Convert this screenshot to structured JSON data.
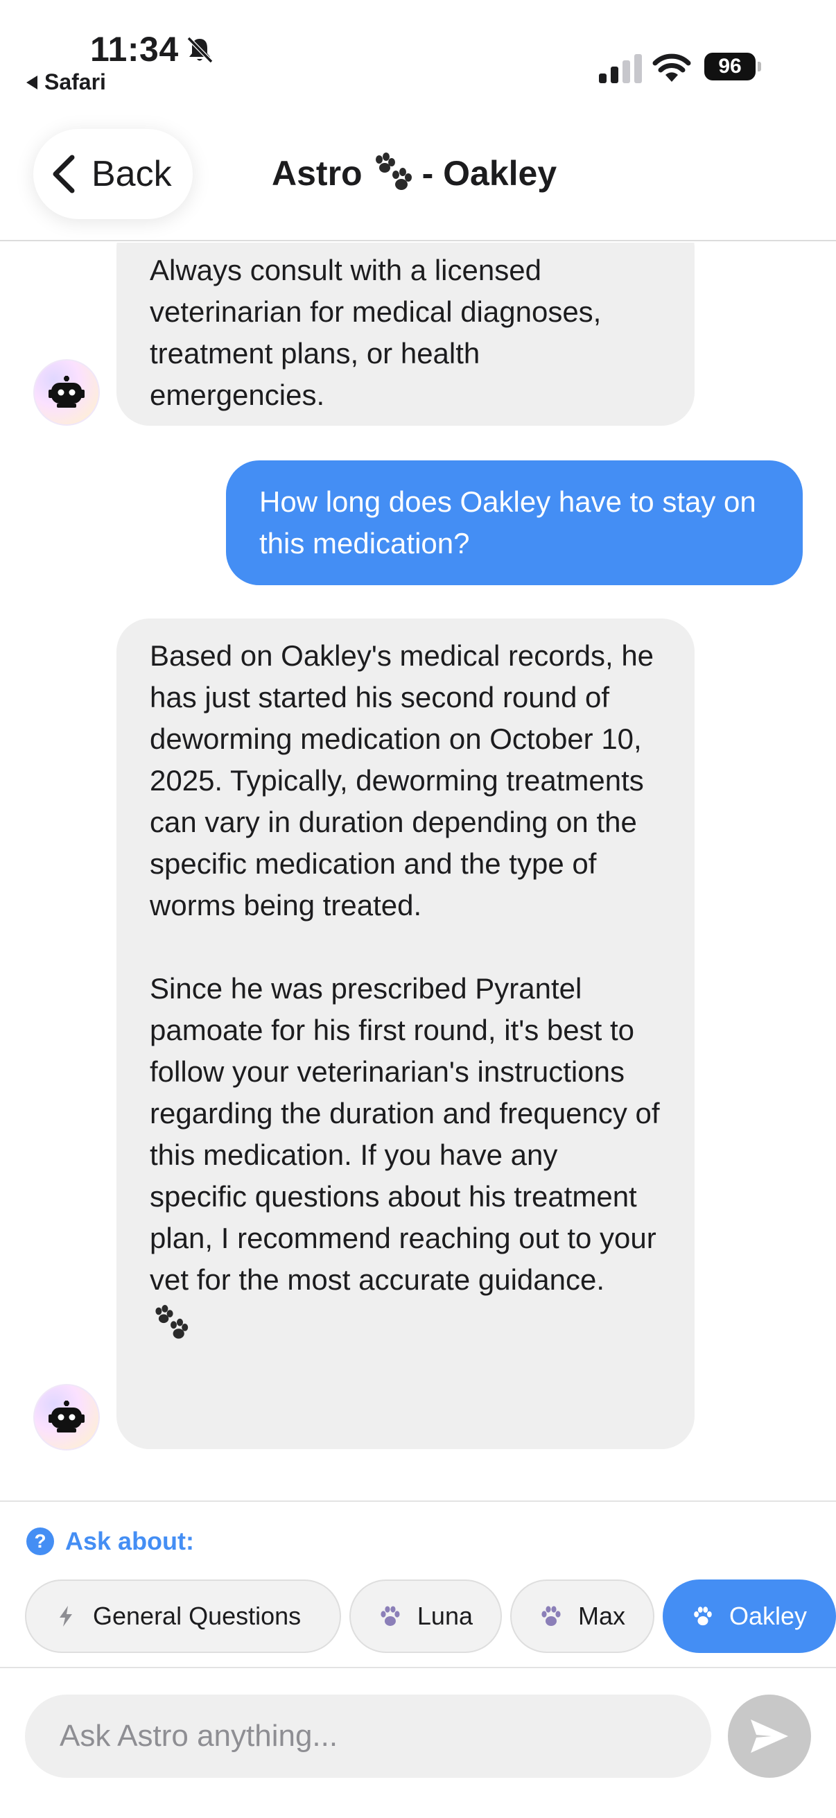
{
  "status_bar": {
    "time": "11:34",
    "back_app": "Safari",
    "battery": "96"
  },
  "nav": {
    "back_label": "Back",
    "title_prefix": "Astro",
    "title_suffix": "- Oakley"
  },
  "messages": [
    {
      "role": "assistant",
      "paragraphs": [
        "Always consult with a licensed veterinarian for medical diagnoses, treatment plans, or health emergencies."
      ]
    },
    {
      "role": "user",
      "paragraphs": [
        "How long does Oakley have to stay on this medication?"
      ]
    },
    {
      "role": "assistant",
      "paragraphs": [
        "Based on Oakley's medical records, he has just started his second round of deworming medication on October 10, 2025. Typically, deworming treatments can vary in duration depending on the specific medication and the type of worms being treated.",
        "Since he was prescribed Pyrantel pamoate for his first round, it's best to follow your veterinarian's instructions regarding the duration and frequency of this medication. If you have any specific questions about his treatment plan, I recommend reaching out to your vet for the most accurate guidance."
      ]
    }
  ],
  "ask_about": {
    "label": "Ask about:",
    "chips": [
      {
        "label": "General Questions",
        "icon": "lightning-icon",
        "active": false
      },
      {
        "label": "Luna",
        "icon": "paw-icon",
        "active": false
      },
      {
        "label": "Max",
        "icon": "paw-icon",
        "active": false
      },
      {
        "label": "Oakley",
        "icon": "paw-icon",
        "active": true
      }
    ]
  },
  "input": {
    "placeholder": "Ask Astro anything..."
  },
  "colors": {
    "accent": "#448ef4",
    "bot_bubble": "#efefef",
    "send_disabled": "#c8c8c8"
  }
}
